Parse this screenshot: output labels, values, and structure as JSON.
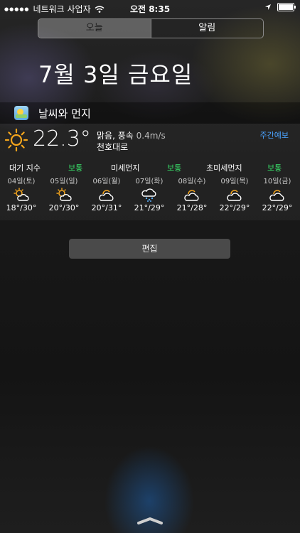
{
  "status_bar": {
    "carrier": "네트워크 사업자",
    "time": "오전 8:35"
  },
  "segments": [
    {
      "label": "오늘",
      "active": true
    },
    {
      "label": "알림",
      "active": false
    }
  ],
  "date_title": "7월 3일 금요일",
  "widget": {
    "title": "날씨와 먼지",
    "current": {
      "temp": "22.3°",
      "condition": "맑음, 풍속",
      "wind": "0.4m/s",
      "location": "천호대로",
      "icon": "sun-icon"
    },
    "weekly_link": "주간예보",
    "air_quality": [
      {
        "label": "대기 지수",
        "status": "보통"
      },
      {
        "label": "미세먼지",
        "status": "보통"
      },
      {
        "label": "초미세먼지",
        "status": "보통"
      }
    ],
    "forecast": [
      {
        "day": "04일(토)",
        "icon": "partly-cloudy-icon",
        "temps": "18°/30°"
      },
      {
        "day": "05일(일)",
        "icon": "partly-cloudy-icon",
        "temps": "20°/30°"
      },
      {
        "day": "06일(월)",
        "icon": "cloud-sun-icon",
        "temps": "20°/31°"
      },
      {
        "day": "07일(화)",
        "icon": "rain-cloud-icon",
        "temps": "21°/29°"
      },
      {
        "day": "08일(수)",
        "icon": "cloud-sun-icon",
        "temps": "21°/28°"
      },
      {
        "day": "09일(목)",
        "icon": "cloud-sun-icon",
        "temps": "22°/29°"
      },
      {
        "day": "10일(금)",
        "icon": "cloud-sun-icon",
        "temps": "22°/29°"
      }
    ]
  },
  "edit_button": "편집"
}
